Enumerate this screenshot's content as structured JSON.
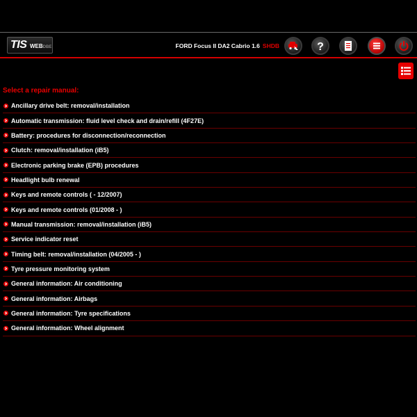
{
  "header": {
    "logo_main": "TIS",
    "logo_web": "WEB",
    "logo_suffix": "DBE",
    "vehicle": "FORD Focus II DA2 Cabrio 1.6",
    "engine_code": "SHDB"
  },
  "toolbar": {
    "buttons": [
      {
        "name": "vehicle-select",
        "icon": "car-arrow-icon"
      },
      {
        "name": "help",
        "icon": "question-icon"
      },
      {
        "name": "documents",
        "icon": "document-icon"
      },
      {
        "name": "menu",
        "icon": "menu-icon"
      },
      {
        "name": "power",
        "icon": "power-icon"
      }
    ]
  },
  "content": {
    "heading": "Select a repair manual:",
    "items": [
      "Ancillary drive belt: removal/installation",
      "Automatic transmission: fluid level check and drain/refill (4F27E)",
      "Battery: procedures for disconnection/reconnection",
      "Clutch: removal/installation (iB5)",
      "Electronic parking brake (EPB) procedures",
      "Headlight bulb renewal",
      "Keys and remote controls ( - 12/2007)",
      "Keys and remote controls (01/2008 - )",
      "Manual transmission: removal/installation (iB5)",
      "Service indicator reset",
      "Timing belt: removal/installation (04/2005 - )",
      "Tyre pressure monitoring system",
      "General information: Air conditioning",
      "General information: Airbags",
      "General information: Tyre specifications",
      "General information: Wheel alignment"
    ]
  },
  "colors": {
    "accent": "#e60000",
    "background": "#000000",
    "divider": "#6a0000"
  }
}
